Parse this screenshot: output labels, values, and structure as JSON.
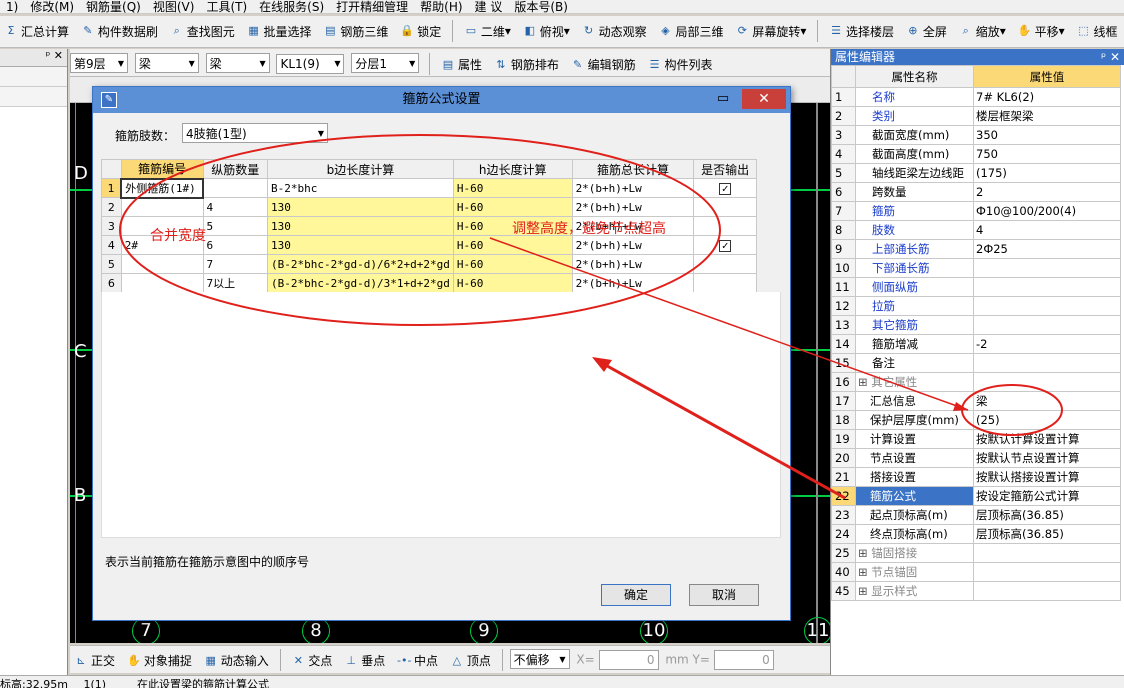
{
  "menubar": {
    "items": [
      "1)",
      "修改(M)",
      "钢筋量(Q)",
      "视图(V)",
      "工具(T)",
      "在线服务(S)",
      "打开精细管理",
      "帮助(H)",
      "建 议",
      "版本号(B)"
    ]
  },
  "toolbar": {
    "buttons": [
      "汇总计算",
      "构件数据刷",
      "查找图元",
      "批量选择",
      "钢筋三维",
      "锁定",
      "二维",
      "俯视",
      "动态观察",
      "局部三维",
      "屏幕旋转",
      "选择楼层",
      "全屏",
      "缩放",
      "平移",
      "线框"
    ]
  },
  "toolbar2": {
    "combos": [
      "第9层",
      "梁",
      "梁",
      "KL1(9)",
      "分层1"
    ],
    "buttons": [
      "属性",
      "钢筋排布",
      "编辑钢筋",
      "构件列表"
    ]
  },
  "left_panel": {
    "pin": "ᵖ ✕"
  },
  "dialog": {
    "title": "箍筋公式设置",
    "legs_label": "箍筋肢数：",
    "legs_value": "4肢箍(1型)",
    "columns": [
      "箍筋编号",
      "纵筋数量",
      "b边长度计算",
      "h边长度计算",
      "箍筋总长计算",
      "是否输出"
    ],
    "rows": [
      {
        "num": "1",
        "id": "外侧箍筋(1#)",
        "qty": "",
        "b": "B-2*bhc",
        "h": "H-60",
        "total": "2*(b+h)+Lw",
        "out": true
      },
      {
        "num": "2",
        "id": "",
        "qty": "4",
        "b": "130",
        "h": "H-60",
        "total": "2*(b+h)+Lw",
        "out": false
      },
      {
        "num": "3",
        "id": "",
        "qty": "5",
        "b": "130",
        "h": "H-60",
        "total": "2*(b+h)+Lw",
        "out": false
      },
      {
        "num": "4",
        "id": "2#",
        "qty": "6",
        "b": "130",
        "h": "H-60",
        "total": "2*(b+h)+Lw",
        "out": true
      },
      {
        "num": "5",
        "id": "",
        "qty": "7",
        "b": "(B-2*bhc-2*gd-d)/6*2+d+2*gd",
        "h": "H-60",
        "total": "2*(b+h)+Lw",
        "out": false
      },
      {
        "num": "6",
        "id": "",
        "qty": "7以上",
        "b": "(B-2*bhc-2*gd-d)/3*1+d+2*gd",
        "h": "H-60",
        "total": "2*(b+h)+Lw",
        "out": false
      }
    ],
    "hint": "表示当前箍筋在箍筋示意图中的顺序号",
    "ok": "确定",
    "cancel": "取消"
  },
  "annotations": {
    "merge_width": "合并宽度",
    "adjust_height": "调整高度，避免节点超高"
  },
  "canvas": {
    "axis_labels": [
      "7",
      "8",
      "9",
      "10",
      "11"
    ],
    "row_labels": [
      "D",
      "C",
      "B"
    ]
  },
  "statusbar": {
    "items": [
      "正交",
      "对象捕捉",
      "动态输入",
      "交点",
      "垂点",
      "中点",
      "顶点",
      "不偏移",
      "X=",
      "0",
      "mm",
      "Y=",
      "0"
    ]
  },
  "bottom": {
    "text1": "标高:32.95m",
    "text2": "1(1)",
    "text3": "在此设置梁的箍筋计算公式"
  },
  "property_panel": {
    "title": "属性编辑器",
    "col_name": "属性名称",
    "col_value": "属性值",
    "rows": [
      {
        "n": "1",
        "name": "名称",
        "value": "7#  KL6(2)",
        "style": "blue"
      },
      {
        "n": "2",
        "name": "类别",
        "value": "楼层框架梁",
        "style": "blue"
      },
      {
        "n": "3",
        "name": "截面宽度(mm)",
        "value": "350",
        "style": ""
      },
      {
        "n": "4",
        "name": "截面高度(mm)",
        "value": "750",
        "style": ""
      },
      {
        "n": "5",
        "name": "轴线距梁左边线距",
        "value": "(175)",
        "style": ""
      },
      {
        "n": "6",
        "name": "跨数量",
        "value": "2",
        "style": ""
      },
      {
        "n": "7",
        "name": "箍筋",
        "value": "Ф10@100/200(4)",
        "style": "blue"
      },
      {
        "n": "8",
        "name": "肢数",
        "value": "4",
        "style": "blue"
      },
      {
        "n": "9",
        "name": "上部通长筋",
        "value": "2Ф25",
        "style": "blue"
      },
      {
        "n": "10",
        "name": "下部通长筋",
        "value": "",
        "style": "blue"
      },
      {
        "n": "11",
        "name": "侧面纵筋",
        "value": "",
        "style": "blue"
      },
      {
        "n": "12",
        "name": "拉筋",
        "value": "",
        "style": "blue"
      },
      {
        "n": "13",
        "name": "其它箍筋",
        "value": "",
        "style": "blue"
      },
      {
        "n": "14",
        "name": "箍筋增减",
        "value": "-2",
        "style": ""
      },
      {
        "n": "15",
        "name": "备注",
        "value": "",
        "style": ""
      },
      {
        "n": "16",
        "name": "其它属性",
        "value": "",
        "style": "gray"
      },
      {
        "n": "17",
        "name": "汇总信息",
        "value": "梁",
        "style": "sub"
      },
      {
        "n": "18",
        "name": "保护层厚度(mm)",
        "value": "(25)",
        "style": "sub"
      },
      {
        "n": "19",
        "name": "计算设置",
        "value": "按默认计算设置计算",
        "style": "sub"
      },
      {
        "n": "20",
        "name": "节点设置",
        "value": "按默认节点设置计算",
        "style": "sub"
      },
      {
        "n": "21",
        "name": "搭接设置",
        "value": "按默认搭接设置计算",
        "style": "sub"
      },
      {
        "n": "22",
        "name": "箍筋公式",
        "value": "按设定箍筋公式计算",
        "style": "sel"
      },
      {
        "n": "23",
        "name": "起点顶标高(m)",
        "value": "层顶标高(36.85)",
        "style": "sub"
      },
      {
        "n": "24",
        "name": "终点顶标高(m)",
        "value": "层顶标高(36.85)",
        "style": "sub"
      },
      {
        "n": "25",
        "name": "锚固搭接",
        "value": "",
        "style": "gray"
      },
      {
        "n": "40",
        "name": "节点锚固",
        "value": "",
        "style": "gray"
      },
      {
        "n": "45",
        "name": "显示样式",
        "value": "",
        "style": "gray"
      }
    ]
  },
  "colors": {
    "accent": "#3b73c6",
    "header_highlight": "#fcd977",
    "formula_fill": "#fff799",
    "annotation": "#e0201a"
  }
}
